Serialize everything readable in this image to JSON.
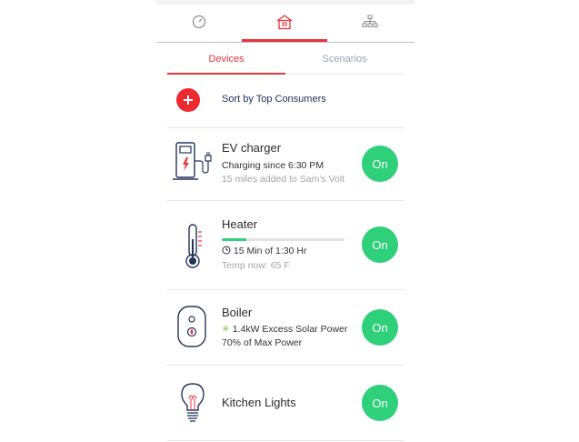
{
  "colors": {
    "accent": "#e8343b",
    "on_button": "#2fd07a",
    "navy": "#23345c"
  },
  "top_nav": {
    "tabs": [
      {
        "icon": "gauge-icon",
        "active": false
      },
      {
        "icon": "home-icon",
        "active": true
      },
      {
        "icon": "network-icon",
        "active": false
      }
    ]
  },
  "sub_tabs": {
    "devices": "Devices",
    "scenarios": "Scenarios"
  },
  "sort": {
    "label": "Sort by Top Consumers",
    "add_icon": "plus-icon"
  },
  "devices": [
    {
      "name": "EV charger",
      "icon": "ev-charger-icon",
      "line1": "Charging since 6:30 PM",
      "line2": "15 miles added to Sam's Volt",
      "button": "On"
    },
    {
      "name": "Heater",
      "icon": "thermometer-icon",
      "progress": 0.2,
      "line1": "15 Min of 1:30 Hr",
      "line2": "Temp now: 65 F",
      "button": "On"
    },
    {
      "name": "Boiler",
      "icon": "boiler-icon",
      "line1": "1.4kW Excess Solar Power",
      "line2": "70% of Max Power",
      "button": "On"
    },
    {
      "name": "Kitchen Lights",
      "icon": "light-bulb-icon",
      "button": "On"
    }
  ]
}
